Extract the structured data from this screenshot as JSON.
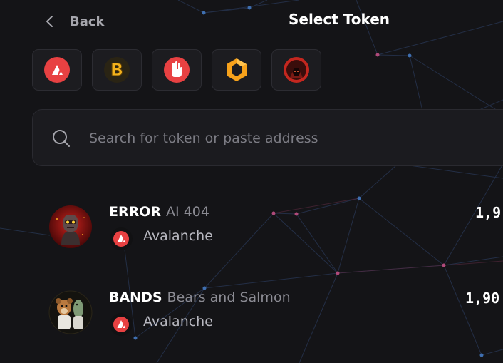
{
  "header": {
    "back_label": "Back",
    "title": "Select Token"
  },
  "quick_tokens": [
    {
      "icon": "avalanche-logo-icon",
      "color": "#e84142"
    },
    {
      "icon": "b-coin-logo-icon",
      "color": "#f3b21c"
    },
    {
      "icon": "red-hand-logo-icon",
      "color": "#e84142"
    },
    {
      "icon": "hexagon-logo-icon",
      "color": "#f7a21b"
    },
    {
      "icon": "hooded-figure-logo-icon",
      "color": "#c4271f"
    }
  ],
  "search": {
    "placeholder": "Search for token or paste address",
    "value": ""
  },
  "tokens": [
    {
      "symbol": "ERROR",
      "name": "AI 404",
      "chain": "Avalanche",
      "balance": "1,9",
      "logo_icon": "robot-avatar-icon"
    },
    {
      "symbol": "BANDS",
      "name": "Bears and Salmon",
      "chain": "Avalanche",
      "balance": "1,90",
      "logo_icon": "bear-and-salmon-avatar-icon"
    }
  ],
  "colors": {
    "background": "#141417",
    "avalanche_red": "#e84142",
    "panel": "#1c1c20"
  }
}
